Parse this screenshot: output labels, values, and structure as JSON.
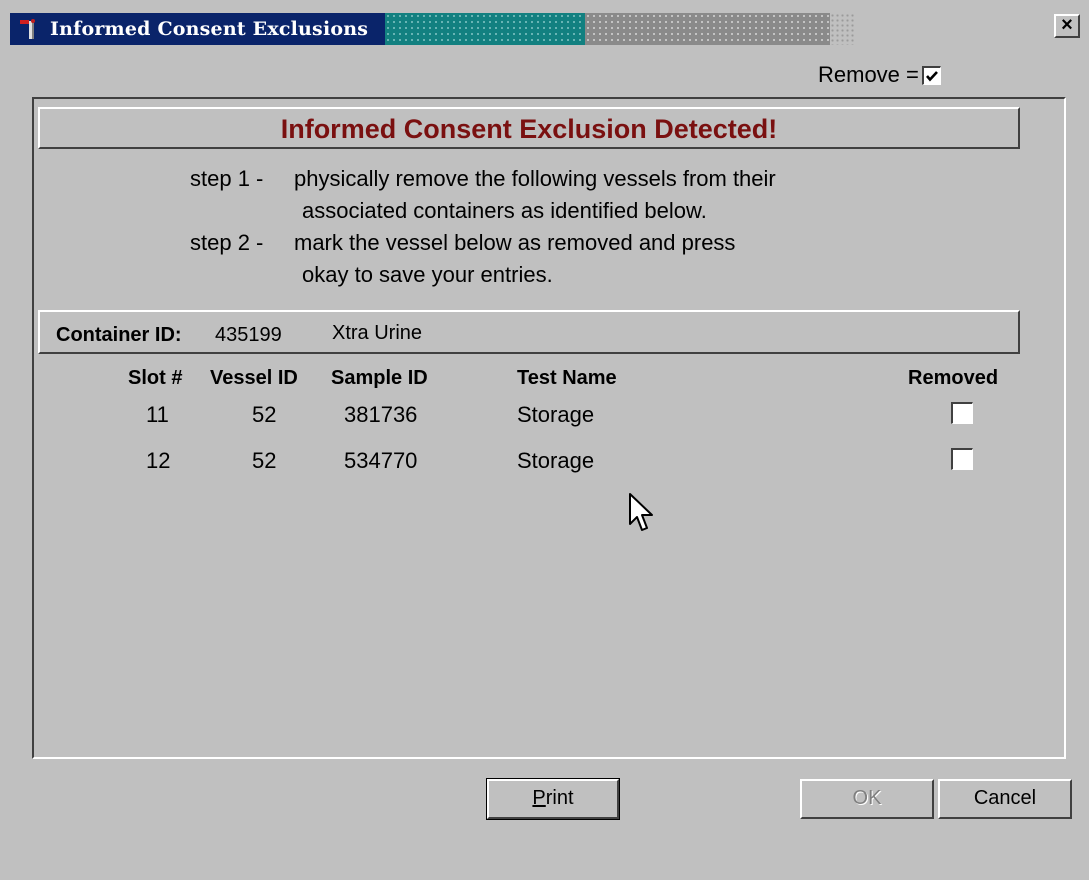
{
  "window": {
    "title": "Informed Consent Exclusions",
    "close_label": "×"
  },
  "legend": {
    "label": "Remove =",
    "checked": true
  },
  "header": {
    "title": "Informed Consent Exclusion Detected!"
  },
  "instructions": {
    "step1_label": "step 1 -",
    "step1_line1": "physically remove the following vessels from their",
    "step1_line2": "associated containers as identified below.",
    "step2_label": "step 2 -",
    "step2_line1": "mark the vessel below as removed and press",
    "step2_line2": "okay to save your entries."
  },
  "container": {
    "label": "Container ID:",
    "id": "435199",
    "type": "Xtra Urine"
  },
  "table": {
    "headers": {
      "slot": "Slot #",
      "vessel": "Vessel ID",
      "sample": "Sample ID",
      "test": "Test Name",
      "removed": "Removed"
    },
    "rows": [
      {
        "slot": "11",
        "vessel": "52",
        "sample": "381736",
        "test": "Storage",
        "removed": false
      },
      {
        "slot": "12",
        "vessel": "52",
        "sample": "534770",
        "test": "Storage",
        "removed": false
      }
    ]
  },
  "buttons": {
    "print_mnemonic": "P",
    "print_rest": "rint",
    "ok": "OK",
    "cancel": "Cancel"
  },
  "colors": {
    "title_bar": "#0a246a",
    "header_text": "#7a1010",
    "background": "#c0c0c0"
  }
}
